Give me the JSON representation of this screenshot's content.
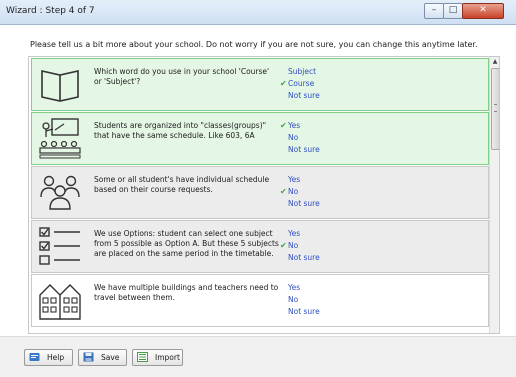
{
  "window": {
    "title": "Wizard : Step 4 of 7",
    "controls": {
      "minimize": "–",
      "maximize": "□",
      "close": "✕"
    }
  },
  "intro": "Please tell us a bit more about your school. Do not worry if you are not sure, you can change this anytime later.",
  "questions": [
    {
      "icon": "book-icon",
      "text": "Which word do you use in your school 'Course' or 'Subject'?",
      "options": [
        "Subject",
        "Course",
        "Not sure"
      ],
      "selected_index": 1,
      "background": "#e4f6e4",
      "border": "#7fcf84"
    },
    {
      "icon": "classroom-icon",
      "text": "Students are organized into \"classes(groups)\" that have the same schedule. Like 603, 6A",
      "options": [
        "Yes",
        "No",
        "Not sure"
      ],
      "selected_index": 0,
      "background": "#e4f6e4",
      "border": "#7fcf84"
    },
    {
      "icon": "group-icon",
      "text": "Some or all student's have individual schedule based on their course requests.",
      "options": [
        "Yes",
        "No",
        "Not sure"
      ],
      "selected_index": 1,
      "background": "#ececec",
      "border": "#c9c9c9"
    },
    {
      "icon": "checklist-icon",
      "text": "We use Options: student can select one subject from 5 possible as Option A. But these 5 subjects are placed on the same period in the timetable.",
      "options": [
        "Yes",
        "No",
        "Not sure"
      ],
      "selected_index": 1,
      "background": "#ececec",
      "border": "#c9c9c9"
    },
    {
      "icon": "buildings-icon",
      "text": "We have multiple buildings and teachers need to travel between them.",
      "options": [
        "Yes",
        "No",
        "Not sure"
      ],
      "selected_index": -1,
      "background": "#ffffff",
      "border": "#c9c9c9"
    }
  ],
  "footer": {
    "help_label": "Help",
    "save_label": "Save",
    "import_label": "Import"
  },
  "colors": {
    "option_link": "#2f4fc3",
    "check_mark": "#3ca63c",
    "selected_row_bg": "#e4f6e4",
    "plain_row_bg": "#ececec"
  }
}
